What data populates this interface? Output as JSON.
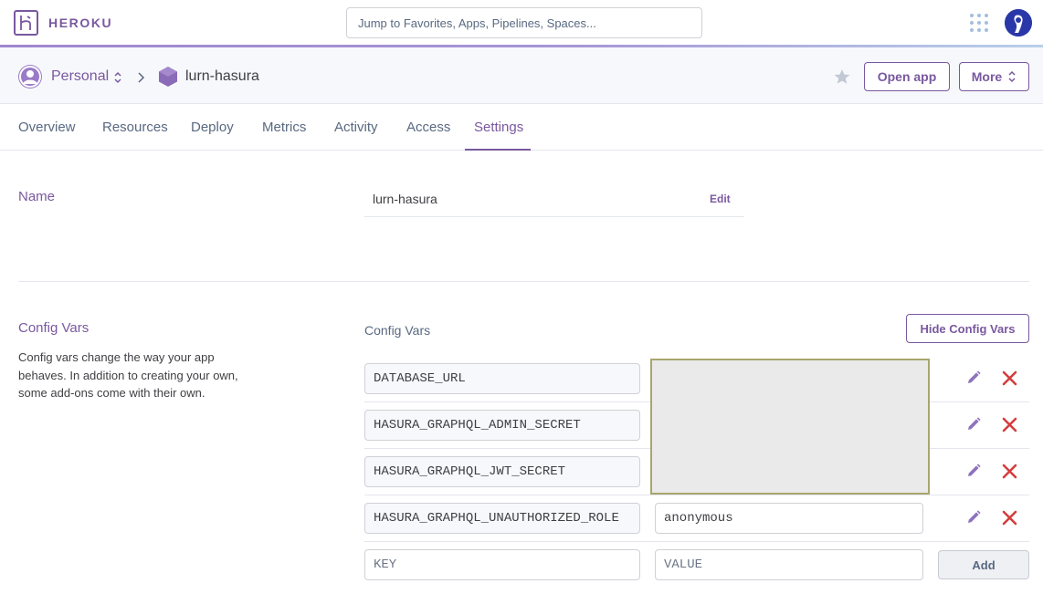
{
  "topbar": {
    "logo_text": "HEROKU",
    "search_placeholder": "Jump to Favorites, Apps, Pipelines, Spaces..."
  },
  "appbar": {
    "account": "Personal",
    "app_name": "lurn-hasura",
    "open_app_label": "Open app",
    "more_label": "More"
  },
  "tabs": [
    {
      "label": "Overview"
    },
    {
      "label": "Resources"
    },
    {
      "label": "Deploy"
    },
    {
      "label": "Metrics"
    },
    {
      "label": "Activity"
    },
    {
      "label": "Access"
    },
    {
      "label": "Settings",
      "active": true
    }
  ],
  "name_section": {
    "title": "Name",
    "value": "lurn-hasura",
    "edit_label": "Edit"
  },
  "config_section": {
    "title": "Config Vars",
    "description": "Config vars change the way your app behaves. In addition to creating your own, some add-ons come with their own.",
    "list_label": "Config Vars",
    "hide_label": "Hide Config Vars",
    "vars": [
      {
        "key": "DATABASE_URL",
        "value": ""
      },
      {
        "key": "HASURA_GRAPHQL_ADMIN_SECRET",
        "value": ""
      },
      {
        "key": "HASURA_GRAPHQL_JWT_SECRET",
        "value": ""
      },
      {
        "key": "HASURA_GRAPHQL_UNAUTHORIZED_ROLE",
        "value": "anonymous"
      }
    ],
    "new_key_placeholder": "KEY",
    "new_value_placeholder": "VALUE",
    "add_label": "Add"
  },
  "colors": {
    "brand": "#79589f",
    "delete": "#d43d3d",
    "muted": "#596981"
  },
  "icons": [
    "heroku-logo-icon",
    "apps-grid-icon",
    "user-avatar",
    "person-icon",
    "chevron-updown-icon",
    "chevron-right-icon",
    "app-hexagon-icon",
    "star-icon",
    "pencil-icon",
    "close-x-icon"
  ]
}
